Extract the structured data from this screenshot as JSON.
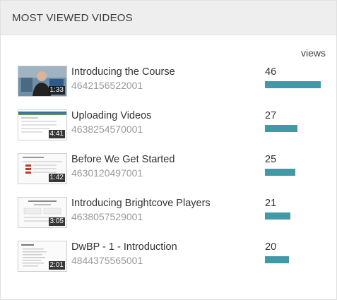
{
  "panel": {
    "title": "MOST VIEWED VIDEOS",
    "views_label": "views"
  },
  "colors": {
    "bar": "#4199a8",
    "header_bg": "#eeeeee"
  },
  "videos": [
    {
      "title": "Introducing the Course",
      "id": "4642156522001",
      "views": "46",
      "views_value": 46,
      "duration": "1:33",
      "thumb": "presenter"
    },
    {
      "title": "Uploading Videos",
      "id": "4638254570001",
      "views": "27",
      "views_value": 27,
      "duration": "4:41",
      "thumb": "screen"
    },
    {
      "title": "Before We Get Started",
      "id": "4630120497001",
      "views": "25",
      "views_value": 25,
      "duration": "1:42",
      "thumb": "slide"
    },
    {
      "title": "Introducing Brightcove Players",
      "id": "4638057529001",
      "views": "21",
      "views_value": 21,
      "duration": "3:05",
      "thumb": "slide"
    },
    {
      "title": "DwBP - 1 - Introduction",
      "id": "4844375565001",
      "views": "20",
      "views_value": 20,
      "duration": "2:01",
      "thumb": "doc"
    }
  ],
  "max_views": 46
}
